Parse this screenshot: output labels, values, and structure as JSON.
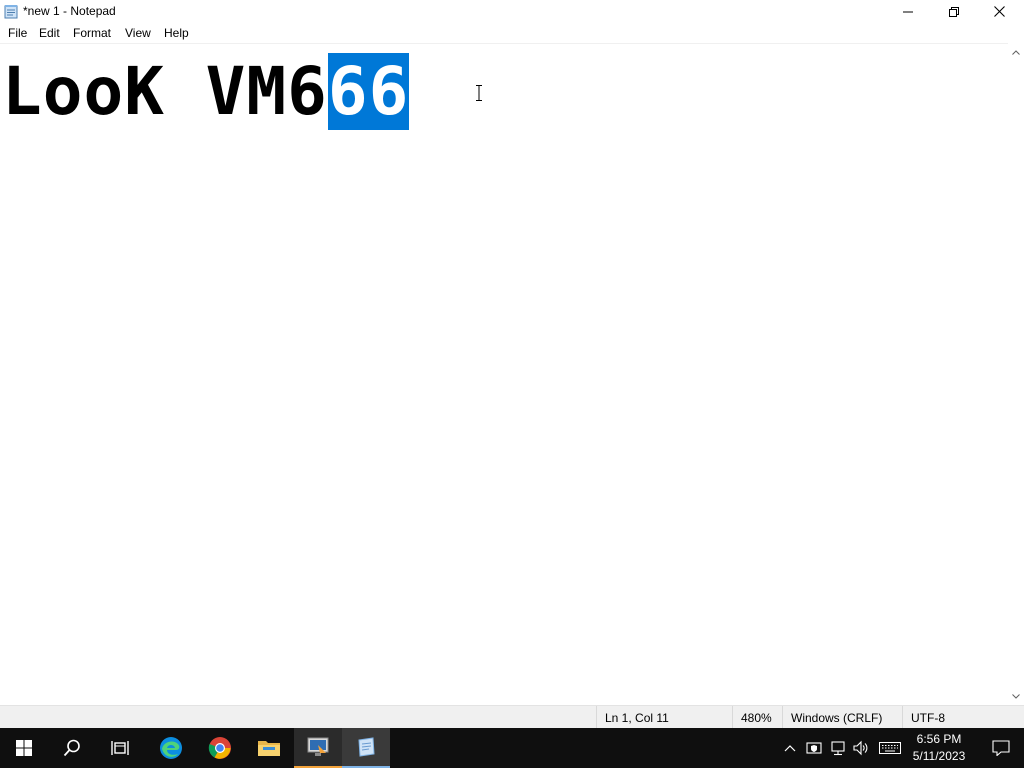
{
  "window": {
    "title": "*new 1 - Notepad"
  },
  "menu": {
    "file": "File",
    "edit": "Edit",
    "format": "Format",
    "view": "View",
    "help": "Help"
  },
  "editor": {
    "text_plain": "LooK VM6",
    "text_selected": "66"
  },
  "status": {
    "position": "Ln 1, Col 11",
    "zoom": "480%",
    "line_ending": "Windows (CRLF)",
    "encoding": "UTF-8"
  },
  "taskbar": {
    "items": [
      "start-icon",
      "search-icon",
      "task-view-icon",
      "edge-icon",
      "chrome-icon",
      "file-explorer-icon",
      "remote-desktop-icon",
      "notepad-icon"
    ],
    "clock_time": "6:56 PM",
    "clock_date": "5/11/2023"
  },
  "colors": {
    "selection": "#0078d7",
    "taskbar": "#0f0f0f"
  }
}
